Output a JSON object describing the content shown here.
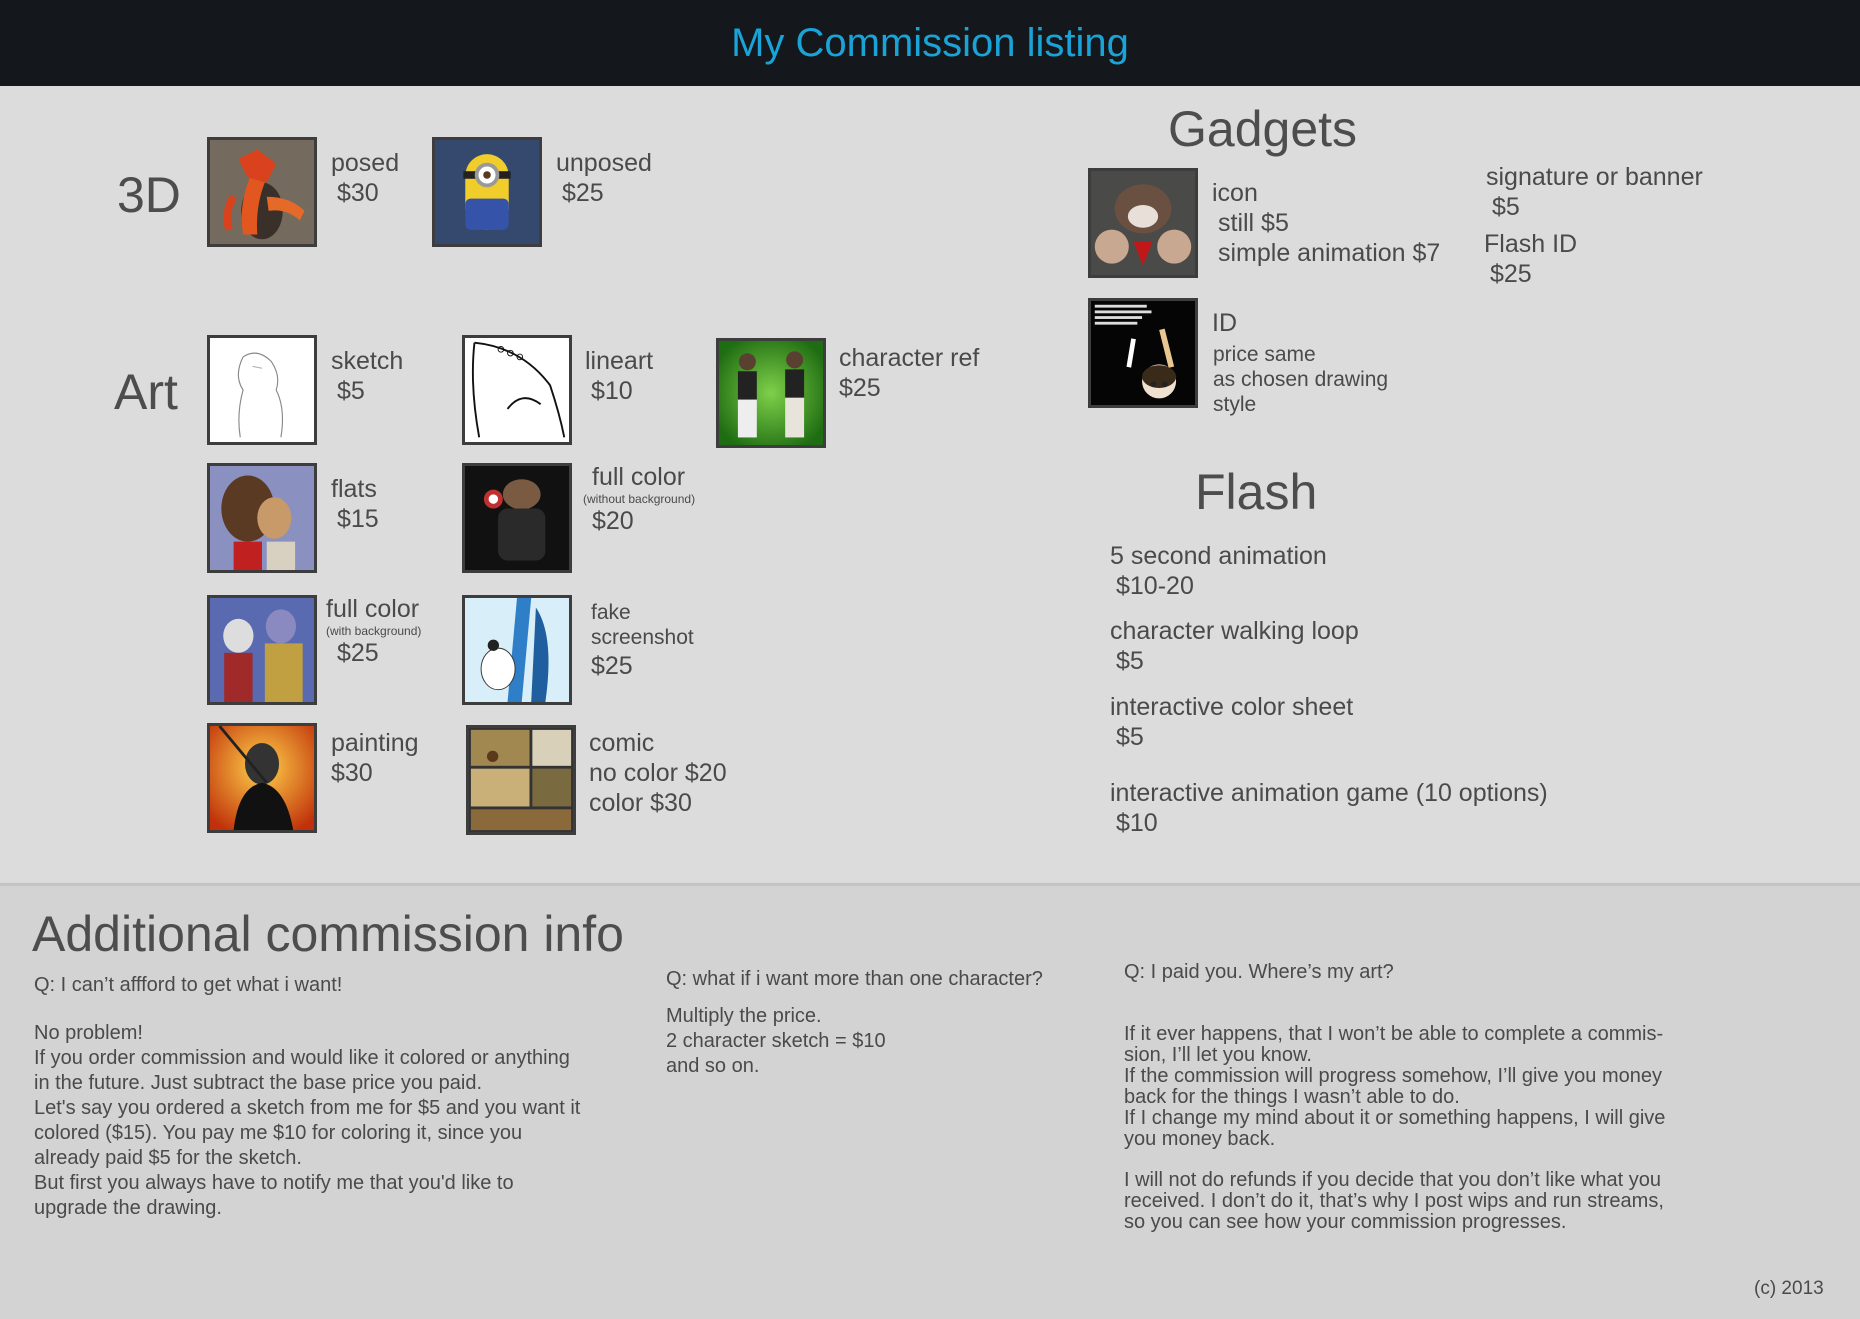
{
  "header": {
    "title": "My Commission listing"
  },
  "sections": {
    "three_d": {
      "title": "3D",
      "items": [
        {
          "name": "posed",
          "price": "$30"
        },
        {
          "name": "unposed",
          "price": "$25"
        }
      ]
    },
    "art": {
      "title": "Art",
      "items": [
        {
          "name": "sketch",
          "price": "$5"
        },
        {
          "name": "lineart",
          "price": "$10"
        },
        {
          "name": "character ref",
          "price": "$25"
        },
        {
          "name": "flats",
          "price": "$15"
        },
        {
          "name": "full color",
          "note": "(without background)",
          "price": "$20"
        },
        {
          "name": "full color",
          "note": "(with background)",
          "price": "$25"
        },
        {
          "name": "fake\nscreenshot",
          "price": "$25"
        },
        {
          "name": "painting",
          "price": "$30"
        },
        {
          "name": "comic",
          "line2": "no color $20",
          "line3": "color $30"
        }
      ]
    },
    "gadgets": {
      "title": "Gadgets",
      "icon": {
        "name": "icon",
        "line2": "still $5",
        "line3": "simple animation $7"
      },
      "signature": {
        "name": "signature or banner",
        "price": "$5"
      },
      "flash_id": {
        "name": "Flash ID",
        "price": "$25"
      },
      "id": {
        "name": "ID",
        "desc": "price same\nas chosen drawing\nstyle"
      },
      "id_thumb_text": "ID card text"
    },
    "flash": {
      "title": "Flash",
      "items": [
        {
          "name": "5 second animation",
          "price": "$10-20"
        },
        {
          "name": "character walking loop",
          "price": "$5"
        },
        {
          "name": "interactive color sheet",
          "price": "$5"
        },
        {
          "name": "interactive animation game (10 options)",
          "price": "$10"
        }
      ]
    }
  },
  "info": {
    "title": "Additional commission info",
    "col1": {
      "question": "Q: I can’t affford to get what i want!",
      "answer": "No problem!\nIf you order commission and would like it colored or anything\nin the future. Just subtract the base price you paid.\nLet's say you ordered a sketch from me for $5 and you want it\ncolored ($15). You pay me $10 for coloring it, since you\nalready paid $5 for the sketch.\nBut first you always have to notify me that you'd like to\nupgrade the drawing."
    },
    "col2": {
      "question": "Q: what if i want more than one character?",
      "answer": "Multiply the price.\n2 character sketch = $10\nand so on."
    },
    "col3": {
      "question": "Q: I paid you. Where’s my art?",
      "answer1": "If it ever happens, that I won’t be able to complete a commis-\nsion, I’ll let you know.\nIf the commission will progress somehow, I’ll give you money\nback for the things I wasn’t able to do.\nIf I change my mind about it or something happens, I will give\nyou money back.",
      "answer2": "I will not do refunds if you decide that you don’t like what you\nreceived. I don’t do it, that’s why I post wips and run streams,\nso you can see how your commission progresses."
    }
  },
  "footer": {
    "copyright": "(c) 2013"
  }
}
